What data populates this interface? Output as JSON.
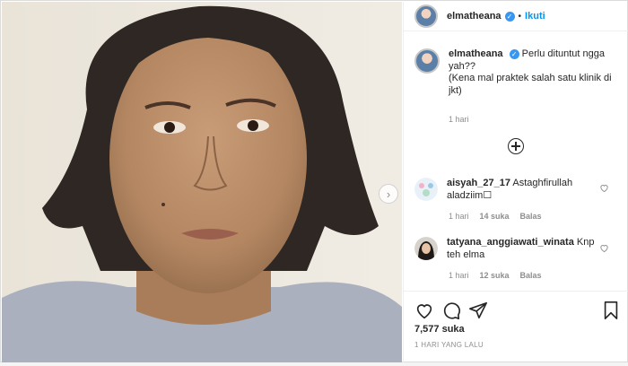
{
  "header": {
    "username": "elmatheana",
    "separator": "•",
    "follow_label": "Ikuti"
  },
  "caption": {
    "username": "elmatheana",
    "line1": "Perlu dituntut ngga yah??",
    "line2": "(Kena mal praktek salah satu klinik di jkt)",
    "time": "1 hari"
  },
  "comments": [
    {
      "username": "aisyah_27_17",
      "text": "Astaghfirullah aladziim☐",
      "time": "1 hari",
      "likes": "14 suka",
      "reply": "Balas"
    },
    {
      "username": "tatyana_anggiawati_winata",
      "text": "Knp teh elma",
      "time": "1 hari",
      "likes": "12 suka",
      "reply": "Balas"
    }
  ],
  "footer": {
    "likes": "7,577 suka",
    "posted": "1 HARI YANG LALU"
  },
  "icons": {
    "verified": "verified-badge-icon",
    "next": "chevron-right-icon",
    "add_comment": "plus-circle-icon",
    "like": "heart-icon",
    "comment": "comment-bubble-icon",
    "share": "paper-plane-icon",
    "save": "bookmark-icon"
  },
  "colors": {
    "accent": "#0095f6",
    "verified": "#3897f0",
    "muted": "#8e8e8e",
    "border": "#dbdbdb"
  }
}
